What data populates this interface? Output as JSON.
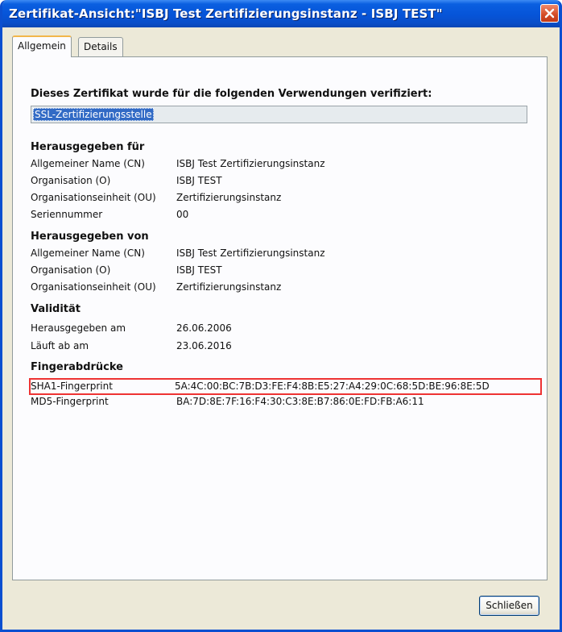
{
  "window": {
    "title": "Zertifikat-Ansicht:\"ISBJ Test Zertifizierungsinstanz - ISBJ TEST\""
  },
  "tabs": [
    {
      "label": "Allgemein",
      "active": true
    },
    {
      "label": "Details",
      "active": false
    }
  ],
  "verify": {
    "heading": "Dieses Zertifikat wurde für die folgenden Verwendungen verifiziert:",
    "usage": "SSL-Zertifizierungsstelle"
  },
  "issued_to": {
    "title": "Herausgegeben für",
    "rows": [
      {
        "label": "Allgemeiner Name (CN)",
        "value": "ISBJ Test Zertifizierungsinstanz"
      },
      {
        "label": "Organisation (O)",
        "value": "ISBJ TEST"
      },
      {
        "label": "Organisationseinheit (OU)",
        "value": "Zertifizierungsinstanz"
      },
      {
        "label": "Seriennummer",
        "value": "00"
      }
    ]
  },
  "issued_by": {
    "title": "Herausgegeben von",
    "rows": [
      {
        "label": "Allgemeiner Name (CN)",
        "value": "ISBJ Test Zertifizierungsinstanz"
      },
      {
        "label": "Organisation (O)",
        "value": "ISBJ TEST"
      },
      {
        "label": "Organisationseinheit (OU)",
        "value": "Zertifizierungsinstanz"
      }
    ]
  },
  "validity": {
    "title": "Validität",
    "rows": [
      {
        "label": "Herausgegeben am",
        "value": "26.06.2006"
      },
      {
        "label": "Läuft ab am",
        "value": "23.06.2016"
      }
    ]
  },
  "fingerprints": {
    "title": "Fingerabdrücke",
    "rows": [
      {
        "label": "SHA1-Fingerprint",
        "value": "5A:4C:00:BC:7B:D3:FE:F4:8B:E5:27:A4:29:0C:68:5D:BE:96:8E:5D"
      },
      {
        "label": "MD5-Fingerprint",
        "value": "BA:7D:8E:7F:16:F4:30:C3:8E:B7:86:0E:FD:FB:A6:11"
      }
    ]
  },
  "footer": {
    "close_label": "Schließen"
  },
  "colors": {
    "titlebar": "#0654d8",
    "selection": "#316ac5",
    "highlight_border": "#ee3333"
  }
}
